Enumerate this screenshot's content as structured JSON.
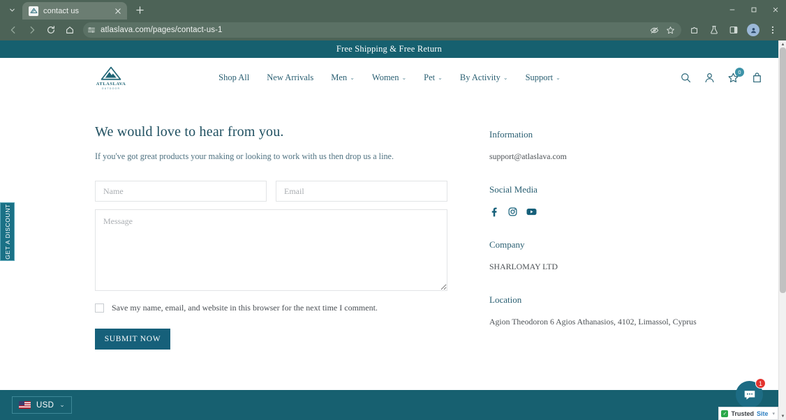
{
  "browser": {
    "tab": {
      "title": "contact us",
      "favicon": "mountain-logo-icon"
    },
    "new_tab_label": "+",
    "url": "atlaslava.com/pages/contact-us-1",
    "window_controls": {
      "minimize": "—",
      "maximize": "□",
      "close": "✕"
    },
    "toolbar_icons": [
      "back-icon",
      "forward-icon",
      "reload-icon",
      "home-icon",
      "site-settings-icon",
      "tracking-protection-icon",
      "bookmark-star-icon",
      "extensions-icon",
      "labs-flask-icon",
      "side-panel-icon",
      "profile-avatar-icon",
      "browser-menu-icon"
    ]
  },
  "announcement": {
    "text": "Free Shipping & Free Return"
  },
  "header": {
    "logo": {
      "name": "ATLASLAVA",
      "sub": "OUTDOOR"
    },
    "nav": [
      {
        "label": "Shop All",
        "has_caret": false
      },
      {
        "label": "New Arrivals",
        "has_caret": false
      },
      {
        "label": "Men",
        "has_caret": true
      },
      {
        "label": "Women",
        "has_caret": true
      },
      {
        "label": "Pet",
        "has_caret": true
      },
      {
        "label": "By Activity",
        "has_caret": true
      },
      {
        "label": "Support",
        "has_caret": true
      }
    ],
    "icons": {
      "search": "search-icon",
      "account": "user-account-icon",
      "wishlist": "wishlist-star-icon",
      "wishlist_count": "0",
      "cart": "shopping-bag-icon"
    }
  },
  "contact": {
    "title": "We would love to hear from you.",
    "subtitle": "If you've got great products your making or looking to work with us then drop us a line.",
    "form": {
      "name_placeholder": "Name",
      "name_value": "",
      "email_placeholder": "Email",
      "email_value": "",
      "message_placeholder": "Message",
      "message_value": "",
      "consent_label": "Save my name, email, and website in this browser for the next time I comment.",
      "submit_label": "SUBMIT NOW"
    }
  },
  "sidebar_info": {
    "information_heading": "Information",
    "email": "support@atlaslava.com",
    "social_heading": "Social Media",
    "socials": [
      "facebook-icon",
      "instagram-icon",
      "youtube-icon"
    ],
    "company_heading": "Company",
    "company": "SHARLOMAY LTD",
    "location_heading": "Location",
    "address": "Agion Theodoron 6 Agios Athanasios, 4102, Limassol, Cyprus"
  },
  "discount_tab": {
    "label": "GET A DISCOUNT"
  },
  "footer": {
    "currency": "USD",
    "flag": "us-flag-icon",
    "caret": "⌄"
  },
  "chat": {
    "badge": "1",
    "icon": "chat-bubble-icon"
  },
  "trusted_site": {
    "part_a": "Trusted",
    "part_b": "Site",
    "check": "✓",
    "caret": "▾"
  },
  "colors": {
    "brand_teal": "#16607a",
    "announce_teal": "#16606f",
    "footer_teal": "#176070",
    "heading": "#1f4f60",
    "chrome": "#4d6357",
    "badge_red": "#e3342f"
  }
}
